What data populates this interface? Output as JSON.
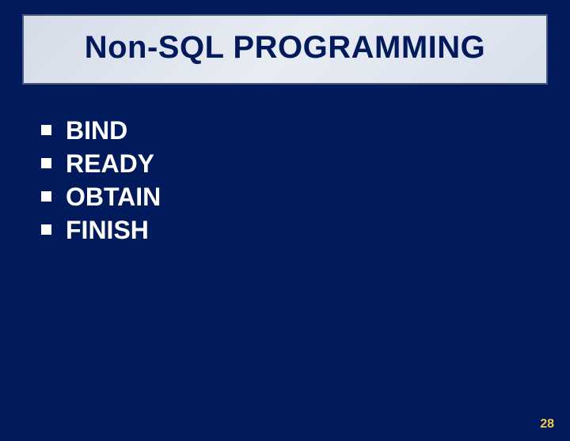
{
  "title": "Non-SQL PROGRAMMING",
  "bullets": {
    "0": "BIND",
    "1": "READY",
    "2": "OBTAIN",
    "3": "FINISH"
  },
  "page_number": "28"
}
